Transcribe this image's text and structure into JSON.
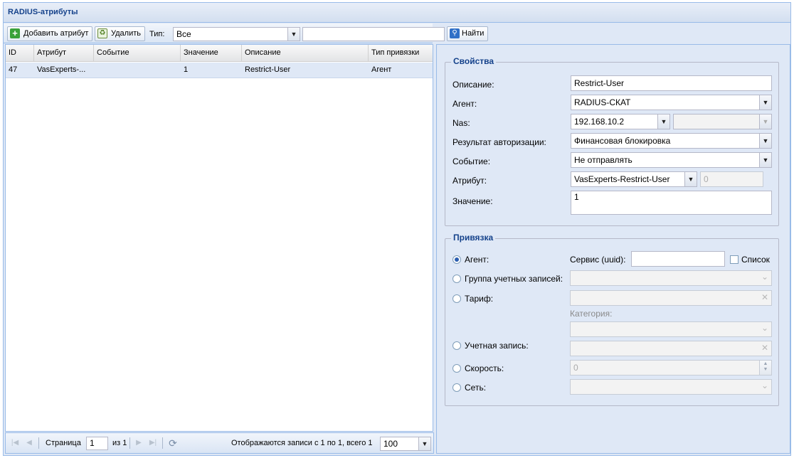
{
  "window": {
    "title": "RADIUS-атрибуты"
  },
  "toolbar": {
    "add_label": "Добавить атрибут",
    "delete_label": "Удалить",
    "type_label": "Тип:",
    "type_value": "Все",
    "search_value": "",
    "find_label": "Найти"
  },
  "grid": {
    "columns": [
      "ID",
      "Атрибут",
      "Событие",
      "Значение",
      "Описание",
      "Тип привязки"
    ],
    "rows": [
      {
        "id": "47",
        "attribute": "VasExperts-...",
        "event": "",
        "value": "1",
        "description": "Restrict-User",
        "binding": "Агент"
      }
    ]
  },
  "pager": {
    "page_label": "Страница",
    "page_value": "1",
    "of_label": "из 1",
    "display_text": "Отображаются записи с 1 по 1, всего 1",
    "page_size": "100"
  },
  "properties": {
    "legend": "Свойства",
    "description_label": "Описание:",
    "description_value": "Restrict-User",
    "agent_label": "Агент:",
    "agent_value": "RADIUS-СКАТ",
    "nas_label": "Nas:",
    "nas_value": "192.168.10.2",
    "nas_second_value": "",
    "auth_result_label": "Результат авторизации:",
    "auth_result_value": "Финансовая блокировка",
    "event_label": "Событие:",
    "event_value": "Не отправлять",
    "attribute_label": "Атрибут:",
    "attribute_value": "VasExperts-Restrict-User",
    "attribute_code": "0",
    "value_label": "Значение:",
    "value_value": "1"
  },
  "binding": {
    "legend": "Привязка",
    "agent_label": "Агент:",
    "service_label": "Сервис (uuid):",
    "service_value": "",
    "list_label": "Список",
    "account_group_label": "Группа учетных записей:",
    "tariff_label": "Тариф:",
    "category_label": "Категория:",
    "account_label": "Учетная запись:",
    "speed_label": "Скорость:",
    "speed_value": "0",
    "network_label": "Сеть:",
    "selected": "agent"
  }
}
